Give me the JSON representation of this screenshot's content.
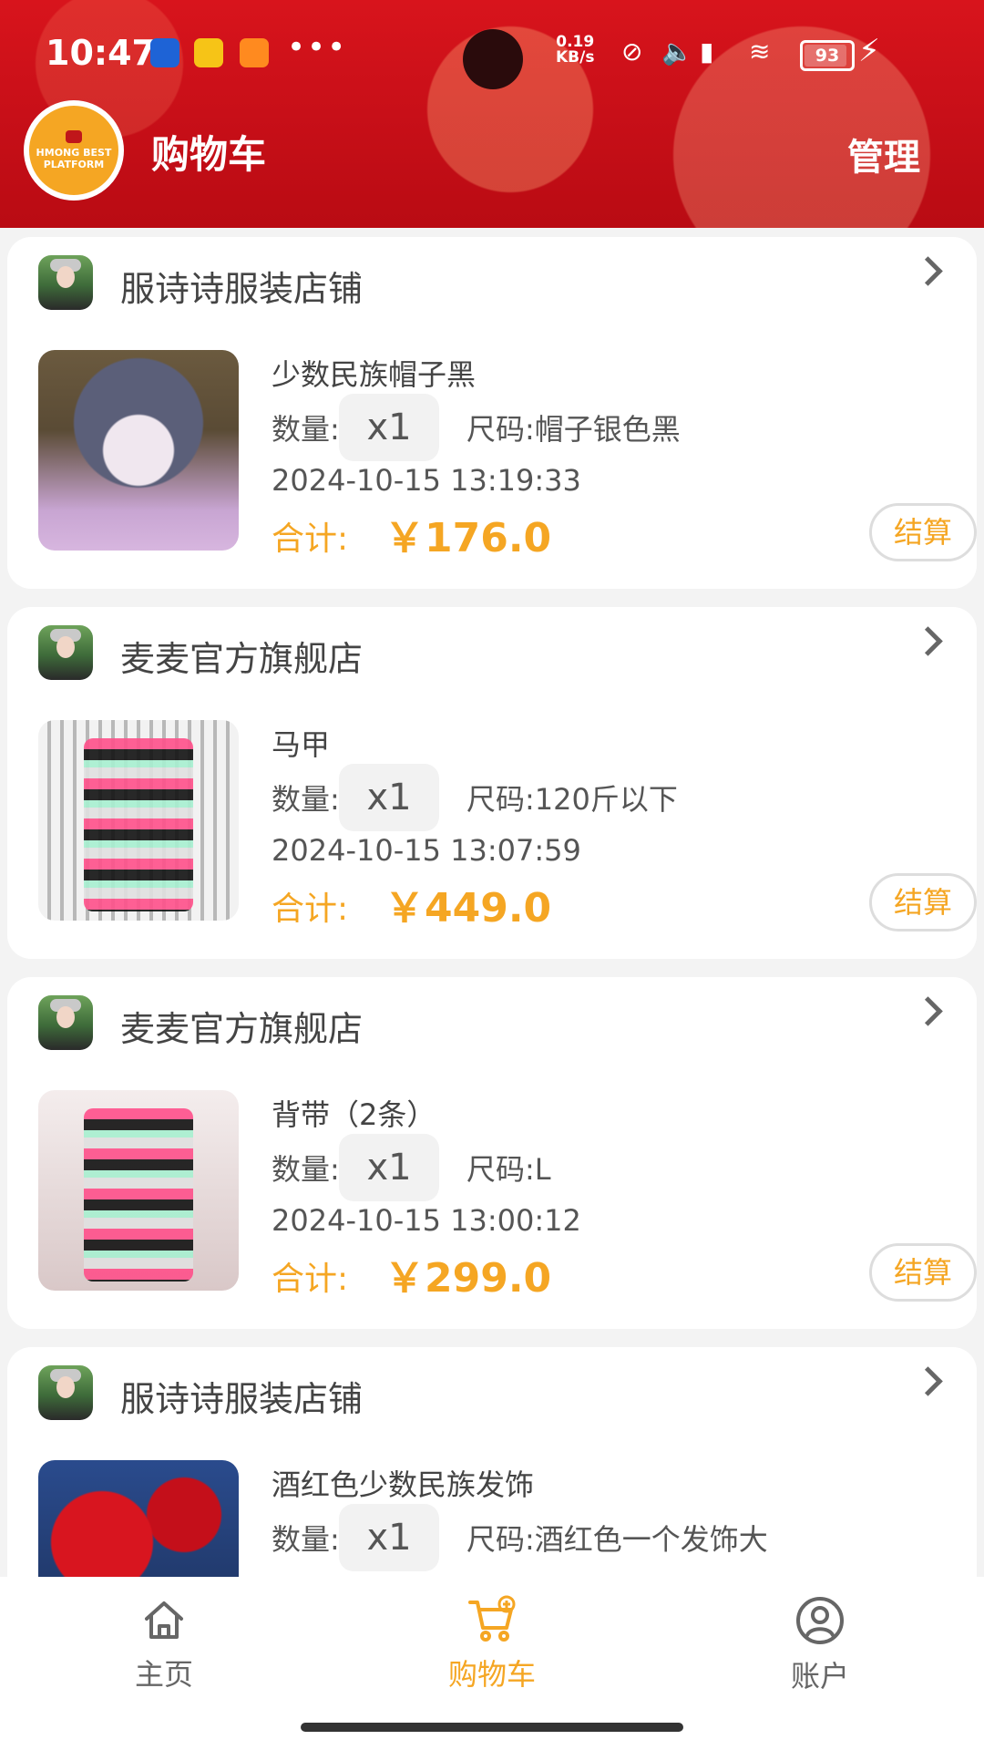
{
  "status_bar": {
    "time": "10:47",
    "network_speed": "0.19\nKB/s",
    "battery": "93",
    "icons": [
      "app-icon-blue",
      "app-icon-yellow",
      "taobao-icon",
      "more-dots",
      "no-sim-icon",
      "volume-icon",
      "signal-icon",
      "wifi-icon",
      "battery-icon",
      "charging-icon"
    ]
  },
  "header": {
    "logo_text": "HMONG BEST\nPLATFORM",
    "title": "购物车",
    "manage_label": "管理"
  },
  "cart": {
    "items": [
      {
        "shop": "服诗诗服装店铺",
        "product": "少数民族帽子黑",
        "qty_label": "数量:",
        "qty": "x1",
        "size": "尺码:帽子银色黑",
        "date": "2024-10-15 13:19:33",
        "total_label": "合计:",
        "price": "￥176.0",
        "checkout": "结算"
      },
      {
        "shop": "麦麦官方旗舰店",
        "product": "马甲",
        "qty_label": "数量:",
        "qty": "x1",
        "size": "尺码:120斤以下",
        "date": "2024-10-15 13:07:59",
        "total_label": "合计:",
        "price": "￥449.0",
        "checkout": "结算"
      },
      {
        "shop": "麦麦官方旗舰店",
        "product": "背带（2条）",
        "qty_label": "数量:",
        "qty": "x1",
        "size": "尺码:L",
        "date": "2024-10-15 13:00:12",
        "total_label": "合计:",
        "price": "￥299.0",
        "checkout": "结算"
      },
      {
        "shop": "服诗诗服装店铺",
        "product": "酒红色少数民族发饰",
        "qty_label": "数量:",
        "qty": "x1",
        "size": "尺码:酒红色一个发饰大"
      }
    ]
  },
  "bottom_nav": {
    "home": "主页",
    "cart": "购物车",
    "account": "账户"
  },
  "colors": {
    "accent": "#f5a623",
    "header_red": "#c80f18"
  }
}
